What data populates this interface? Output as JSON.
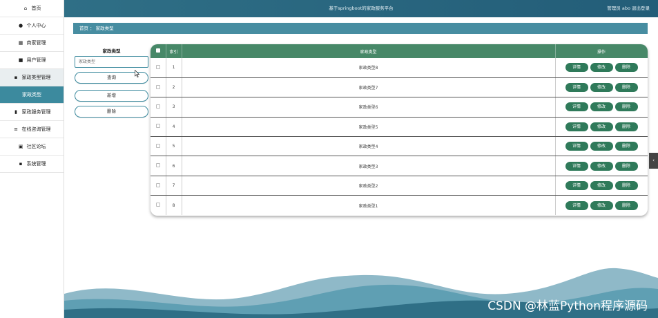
{
  "sidebar": {
    "items": [
      {
        "icon": "home-icon",
        "glyph": "⌂",
        "label": "首页"
      },
      {
        "icon": "user-icon",
        "glyph": "●",
        "label": "个人中心"
      },
      {
        "icon": "store-icon",
        "glyph": "▦",
        "label": "商家管理"
      },
      {
        "icon": "users-icon",
        "glyph": "■",
        "label": "用户管理"
      },
      {
        "icon": "grid-icon",
        "glyph": "▪",
        "label": "家政类型管理"
      },
      {
        "icon": "",
        "glyph": "",
        "label": "家政类型"
      },
      {
        "icon": "chart-icon",
        "glyph": "▮",
        "label": "家政服务管理"
      },
      {
        "icon": "list-icon",
        "glyph": "≡",
        "label": "在线咨询管理"
      },
      {
        "icon": "forum-icon",
        "glyph": "▣",
        "label": "社区论坛"
      },
      {
        "icon": "system-icon",
        "glyph": "▪",
        "label": "系统管理"
      }
    ]
  },
  "header": {
    "title": "基于springboot的家政服务平台",
    "user": "管理员 abo  退出登录"
  },
  "breadcrumb": "首页 ： 家政类型",
  "search": {
    "label": "家政类型",
    "placeholder": "家政类型",
    "query_button": "查询",
    "add_button": "新增",
    "delete_button": "删除"
  },
  "table": {
    "headers": {
      "index": "索引",
      "type": "家政类型",
      "actions": "操作"
    },
    "rows": [
      {
        "index": "1",
        "type": "家政类型8"
      },
      {
        "index": "2",
        "type": "家政类型7"
      },
      {
        "index": "3",
        "type": "家政类型6"
      },
      {
        "index": "4",
        "type": "家政类型5"
      },
      {
        "index": "5",
        "type": "家政类型4"
      },
      {
        "index": "6",
        "type": "家政类型3"
      },
      {
        "index": "7",
        "type": "家政类型2"
      },
      {
        "index": "8",
        "type": "家政类型1"
      }
    ],
    "row_actions": {
      "detail": "详情",
      "edit": "修改",
      "delete": "删除"
    }
  },
  "side_tab": "‹",
  "watermark": "CSDN @林蓝Python程序源码",
  "colors": {
    "header": "#2f6f86",
    "accent": "#3c8a9e",
    "table_header": "#478868",
    "action_button": "#2f7a5a"
  }
}
